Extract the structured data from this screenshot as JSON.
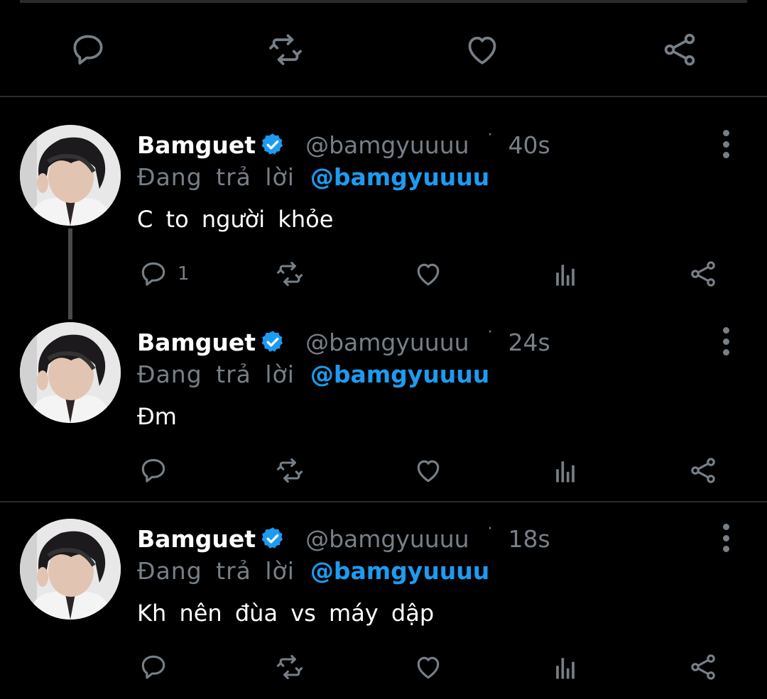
{
  "colors": {
    "background": "#000000",
    "muted": "#777f87",
    "link": "#1d9bf0",
    "text": "#ffffff"
  },
  "top_actions": [
    {
      "icon": "reply-icon"
    },
    {
      "icon": "retweet-icon"
    },
    {
      "icon": "like-icon"
    },
    {
      "icon": "share-icon"
    }
  ],
  "tweets": [
    {
      "name": "Bamguet",
      "handle": "@bamgyuuuu",
      "separator": "·",
      "time": "40s",
      "reply_prefix": "Đang trả lời",
      "reply_to": "@bamgyuuuu",
      "text": "C to người khỏe",
      "reply_count": "1"
    },
    {
      "name": "Bamguet",
      "handle": "@bamgyuuuu",
      "separator": "·",
      "time": "24s",
      "reply_prefix": "Đang trả lời",
      "reply_to": "@bamgyuuuu",
      "text": "Đm",
      "reply_count": ""
    },
    {
      "name": "Bamguet",
      "handle": "@bamgyuuuu",
      "separator": "·",
      "time": "18s",
      "reply_prefix": "Đang trả lời",
      "reply_to": "@bamgyuuuu",
      "text": "Kh nên đùa vs máy dập",
      "reply_count": ""
    }
  ]
}
